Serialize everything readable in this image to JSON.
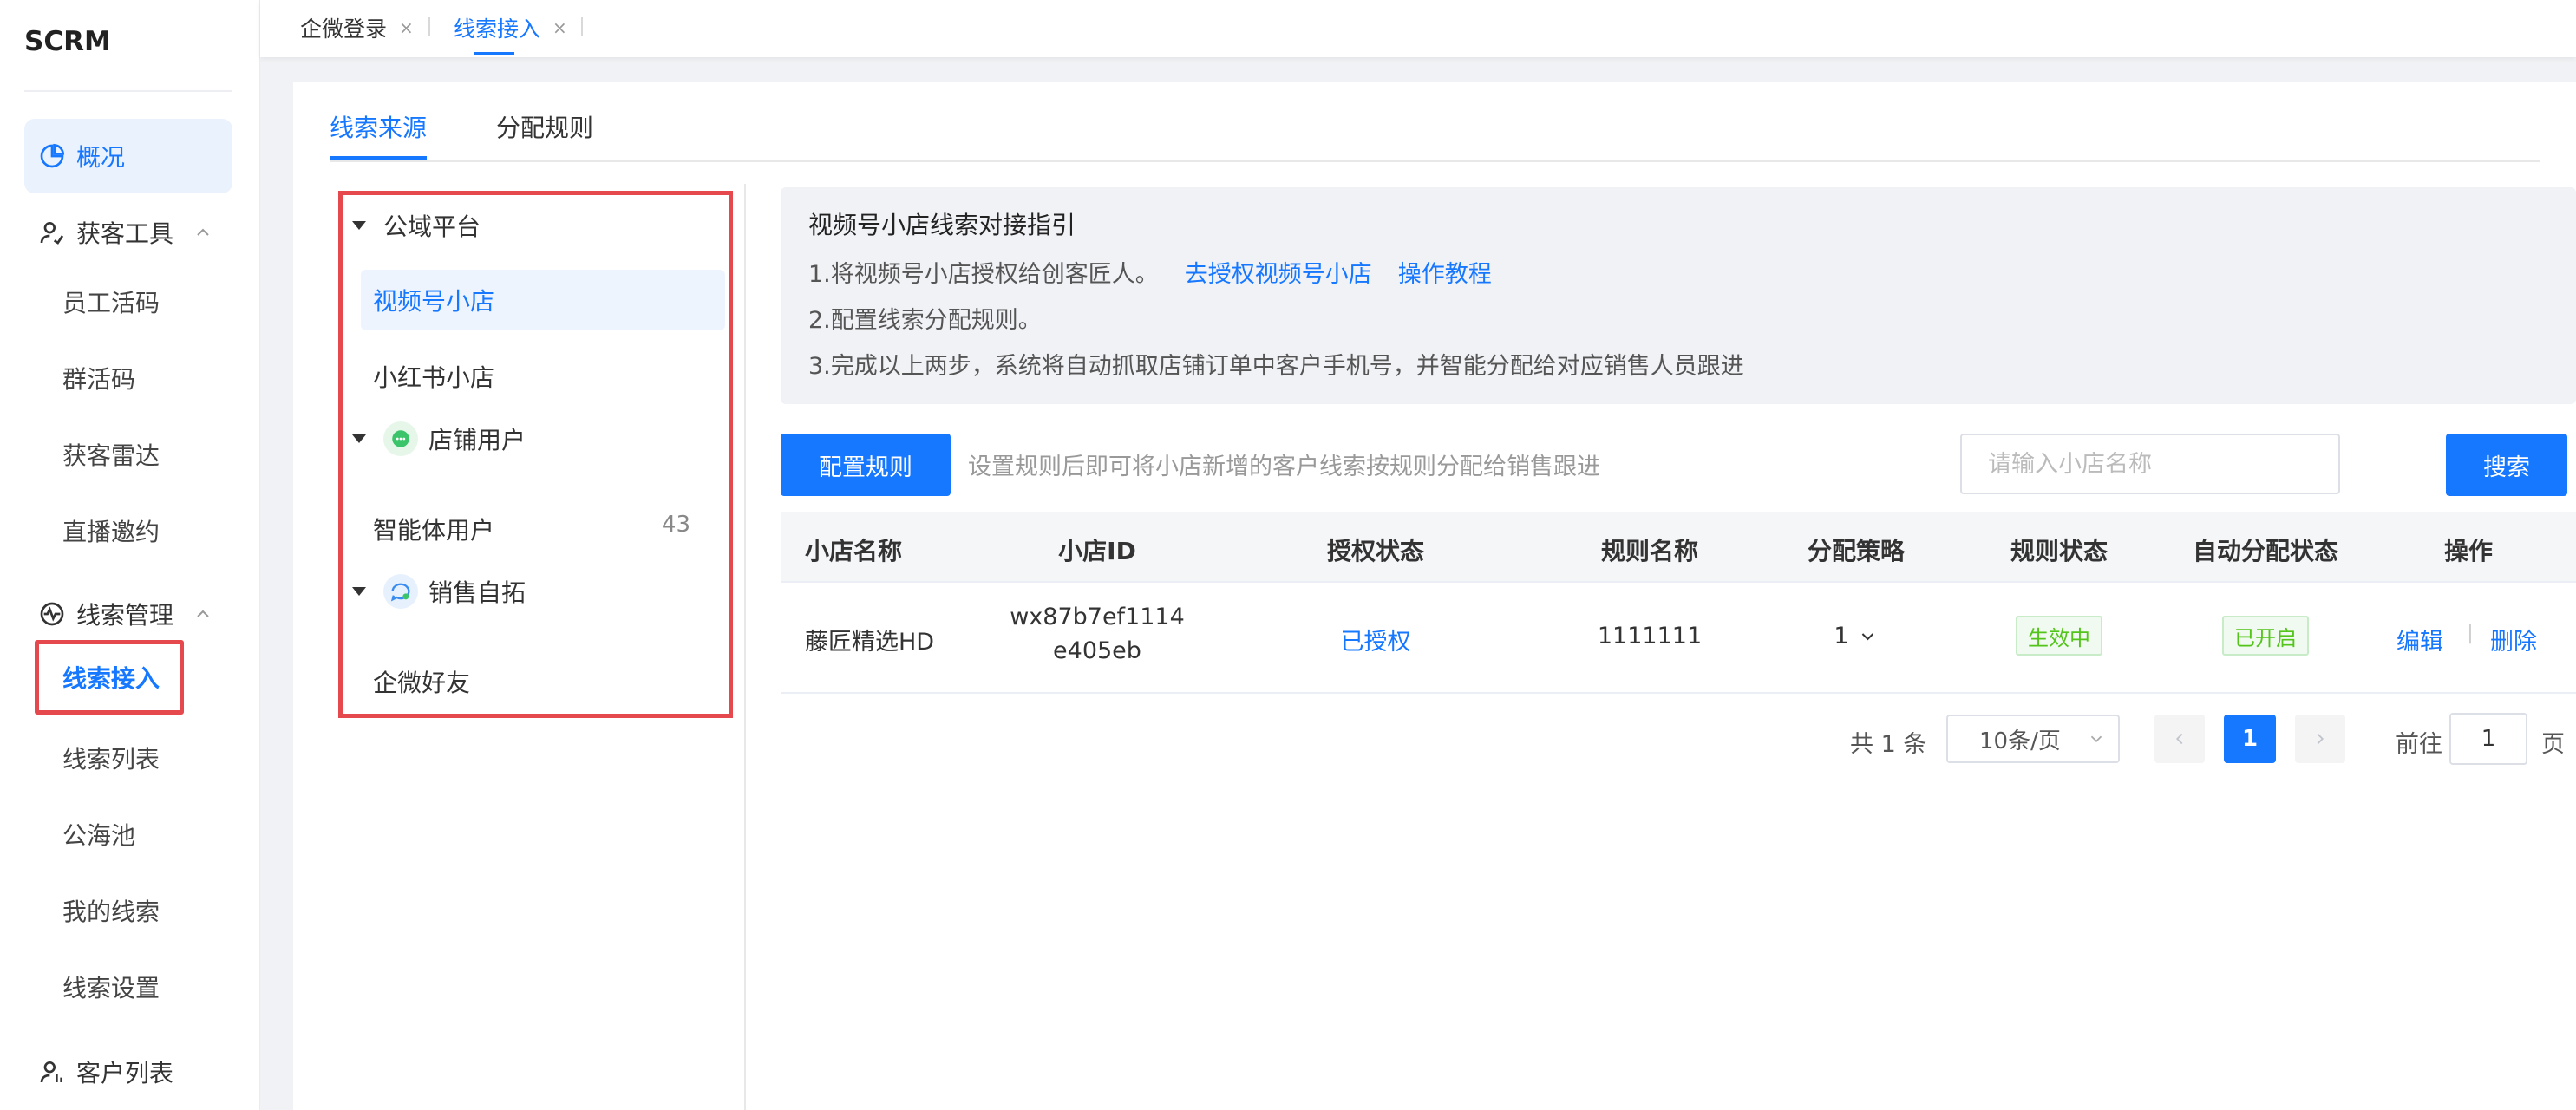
{
  "app": {
    "logo": "SCRM"
  },
  "sidebar": {
    "overview": "概况",
    "acquire_group": "获客工具",
    "acquire_items": [
      "员工活码",
      "群活码",
      "获客雷达",
      "直播邀约"
    ],
    "clue_group": "线索管理",
    "clue_items": [
      "线索接入",
      "线索列表",
      "公海池",
      "我的线索",
      "线索设置"
    ],
    "customer": "客户列表"
  },
  "top_tabs": [
    {
      "label": "企微登录",
      "close": "×"
    },
    {
      "label": "线索接入",
      "close": "×"
    }
  ],
  "content_tabs": [
    "线索来源",
    "分配规则"
  ],
  "tree": {
    "public": "公域平台",
    "public_items": [
      "视频号小店",
      "小红书小店"
    ],
    "shop_users": "店铺用户",
    "shop_items": [
      {
        "label": "智能体用户",
        "count": "43"
      }
    ],
    "sales": "销售自拓",
    "sales_items": [
      "企微好友"
    ]
  },
  "guide": {
    "title": "视频号小店线索对接指引",
    "step1": "1.将视频号小店授权给创客匠人。",
    "step1_link1": "去授权视频号小店",
    "step1_link2": "操作教程",
    "step2": "2.配置线索分配规则。",
    "step3": "3.完成以上两步，系统将自动抓取店铺订单中客户手机号，并智能分配给对应销售人员跟进"
  },
  "toolbar": {
    "config_button": "配置规则",
    "hint": "设置规则后即可将小店新增的客户线索按规则分配给销售跟进",
    "search_placeholder": "请输入小店名称",
    "search_button": "搜索"
  },
  "table": {
    "headers": [
      "小店名称",
      "小店ID",
      "授权状态",
      "规则名称",
      "分配策略",
      "规则状态",
      "自动分配状态",
      "操作"
    ],
    "rows": [
      {
        "name": "藤匠精选HD",
        "id_line1": "wx87b7ef1114",
        "id_line2": "e405eb",
        "auth": "已授权",
        "rule": "1111111",
        "strategy": "1",
        "rule_status": "生效中",
        "auto_status": "已开启",
        "edit": "编辑",
        "delete": "删除"
      }
    ]
  },
  "pagination": {
    "total": "共 1 条",
    "page_size": "10条/页",
    "current_page": "1",
    "goto_label": "前往",
    "goto_value": "1",
    "page_suffix": "页"
  },
  "colors": {
    "primary": "#1677ff",
    "highlight_box": "#e5484d",
    "success": "#52c41a"
  }
}
